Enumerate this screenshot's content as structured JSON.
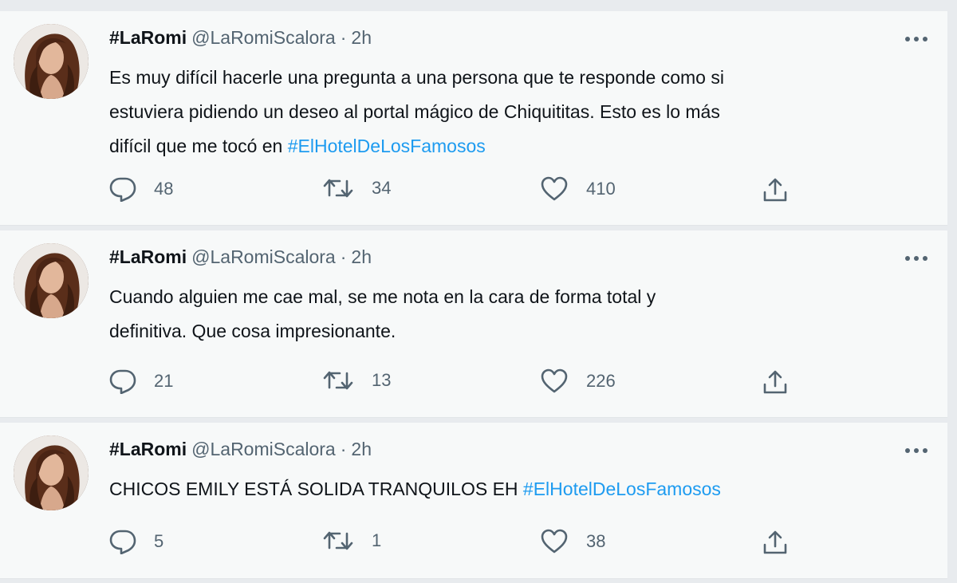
{
  "tweets": [
    {
      "display_name": "#LaRomi",
      "handle": "@LaRomiScalora",
      "separator": "·",
      "time": "2h",
      "text_line1": "Es muy difícil hacerle una pregunta a una persona que te responde como si",
      "text_line2": "estuviera pidiendo un deseo al portal mágico de Chiquititas. Esto es lo más",
      "text_line3_prefix": "difícil que me tocó en ",
      "hashtag": "#ElHotelDeLosFamosos",
      "replies": "48",
      "retweets": "34",
      "likes": "410"
    },
    {
      "display_name": "#LaRomi",
      "handle": "@LaRomiScalora",
      "separator": "·",
      "time": "2h",
      "text_line1": "Cuando alguien me cae mal, se me nota en la cara de forma total y",
      "text_line2": "definitiva. Que cosa impresionante.",
      "replies": "21",
      "retweets": "13",
      "likes": "226"
    },
    {
      "display_name": "#LaRomi",
      "handle": "@LaRomiScalora",
      "separator": "·",
      "time": "2h",
      "text_prefix": "CHICOS EMILY ESTÁ SOLIDA TRANQUILOS EH ",
      "hashtag": "#ElHotelDeLosFamosos",
      "replies": "5",
      "retweets": "1",
      "likes": "38"
    }
  ],
  "colors": {
    "background": "#f7f9f9",
    "text": "#0f1419",
    "secondary": "#536471",
    "link": "#1d9bf0"
  },
  "icons": {
    "reply": "reply-icon",
    "retweet": "retweet-icon",
    "like": "heart-icon",
    "share": "share-icon",
    "more": "more-icon"
  }
}
